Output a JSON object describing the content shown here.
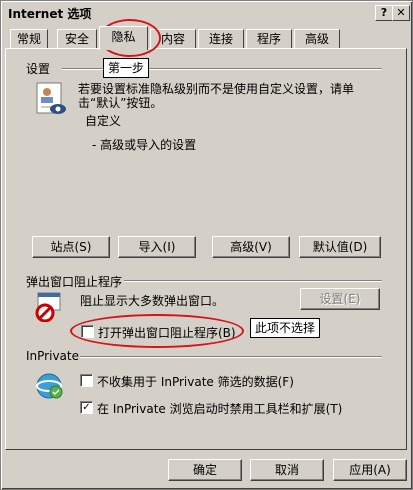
{
  "window": {
    "title": "Internet 选项",
    "help_btn": "?",
    "close_btn": "✕"
  },
  "tabs": [
    "常规",
    "安全",
    "隐私",
    "内容",
    "连接",
    "程序",
    "高级"
  ],
  "settings": {
    "section_label": "设置",
    "description_line1": "若要设置标准隐私级别而不是使用自定义设置，请单",
    "description_line2": "击“默认”按钮。",
    "level": "自定义",
    "detail": "- 高级或导入的设置",
    "buttons": {
      "sites": "站点(S)",
      "import": "导入(I)",
      "advanced": "高级(V)",
      "default": "默认值(D)"
    }
  },
  "popup": {
    "section_label": "弹出窗口阻止程序",
    "description": "阻止显示大多数弹出窗口。",
    "settings_btn": "设置(E)",
    "checkbox_label": "打开弹出窗口阻止程序(B)",
    "checked": false
  },
  "inprivate": {
    "section_label": "InPrivate",
    "opt1_label": "不收集用于 InPrivate 筛选的数据(F)",
    "opt1_checked": false,
    "opt2_label": "在 InPrivate 浏览启动时禁用工具栏和扩展(T)",
    "opt2_checked": true
  },
  "annotations": {
    "step1": "第一步",
    "not_select": "此项不选择",
    "ring_color": "#d4131b"
  },
  "footer": {
    "ok": "确定",
    "cancel": "取消",
    "apply": "应用(A)"
  }
}
